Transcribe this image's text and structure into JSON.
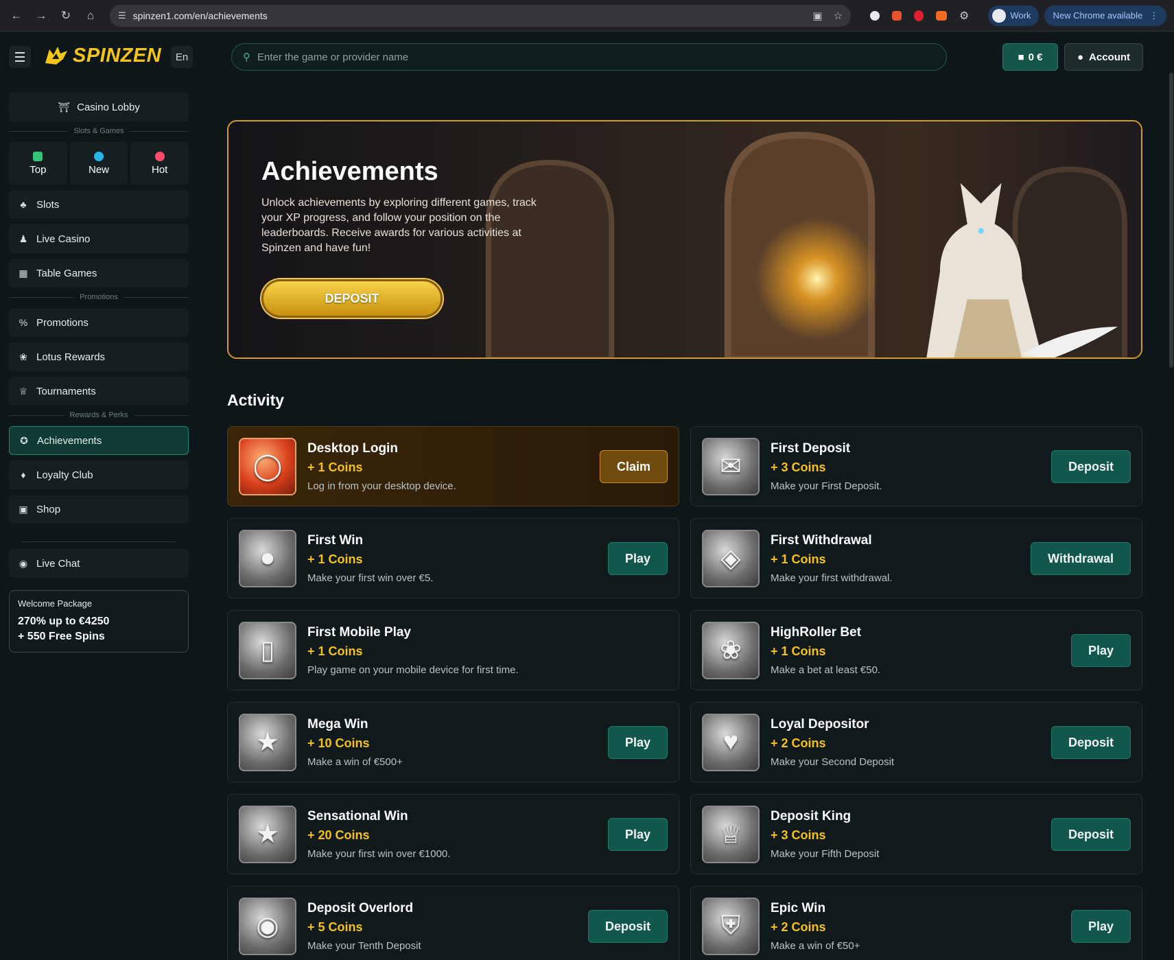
{
  "browser": {
    "url": "spinzen1.com/en/achievements",
    "profile_label": "Work",
    "update_label": "New Chrome available"
  },
  "header": {
    "logo_text": "SPINZEN",
    "language": "En",
    "search_placeholder": "Enter the game or provider name",
    "balance": "0 €",
    "account_label": "Account"
  },
  "sidebar": {
    "casino_lobby": "Casino Lobby",
    "slots_games_divider": "Slots & Games",
    "quick": [
      {
        "label": "Top",
        "color": "#35c27a"
      },
      {
        "label": "New",
        "color": "#2ab5e8"
      },
      {
        "label": "Hot",
        "color": "#ff4d6d"
      }
    ],
    "games": [
      "Slots",
      "Live Casino",
      "Table Games"
    ],
    "promotions_divider": "Promotions",
    "promos": [
      "Promotions",
      "Lotus Rewards",
      "Tournaments"
    ],
    "rewards_divider": "Rewards & Perks",
    "rewards": [
      "Achievements",
      "Loyalty Club",
      "Shop"
    ],
    "live_chat": "Live Chat",
    "welcome": {
      "title": "Welcome Package",
      "line1": "270% up to €4250",
      "line2": "+ 550 Free Spins"
    }
  },
  "hero": {
    "title": "Achievements",
    "description": "Unlock achievements by exploring different games, track your XP progress, and follow your position on the leaderboards. Receive awards for various activities at Spinzen and have fun!",
    "button": "DEPOSIT"
  },
  "activity": {
    "title": "Activity",
    "cards": [
      {
        "title": "Desktop Login",
        "coins": "+ 1 Coins",
        "desc": "Log in from your desktop device.",
        "button": "Claim",
        "icon": "lantern-icon"
      },
      {
        "title": "First Deposit",
        "coins": "+ 3 Coins",
        "desc": "Make your First Deposit.",
        "button": "Deposit",
        "icon": "envelope-icon"
      },
      {
        "title": "First Win",
        "coins": "+ 1 Coins",
        "desc": "Make your first win over €5.",
        "button": "Play",
        "icon": "coin-icon"
      },
      {
        "title": "First Withdrawal",
        "coins": "+ 1 Coins",
        "desc": "Make your first withdrawal.",
        "button": "Withdrawal",
        "icon": "money-bag-icon"
      },
      {
        "title": "First Mobile Play",
        "coins": "+ 1 Coins",
        "desc": "Play game on your mobile device for first time.",
        "button": "",
        "icon": "phone-icon"
      },
      {
        "title": "HighRoller Bet",
        "coins": "+ 1 Coins",
        "desc": "Make a bet at least €50.",
        "button": "Play",
        "icon": "lotus-icon"
      },
      {
        "title": "Mega Win",
        "coins": "+ 10 Coins",
        "desc": "Make a win of €500+",
        "button": "Play",
        "icon": "star-wreath-icon"
      },
      {
        "title": "Loyal Depositor",
        "coins": "+ 2 Coins",
        "desc": "Make your Second Deposit",
        "button": "Deposit",
        "icon": "heart-coin-icon"
      },
      {
        "title": "Sensational Win",
        "coins": "+ 20 Coins",
        "desc": "Make your first win over €1000.",
        "button": "Play",
        "icon": "star-wreath-icon"
      },
      {
        "title": "Deposit King",
        "coins": "+ 3 Coins",
        "desc": "Make your Fifth Deposit",
        "button": "Deposit",
        "icon": "crown-coins-icon"
      },
      {
        "title": "Deposit Overlord",
        "coins": "+ 5 Coins",
        "desc": "Make your Tenth Deposit",
        "button": "Deposit",
        "icon": "coin-pouch-icon"
      },
      {
        "title": "Epic Win",
        "coins": "+ 2 Coins",
        "desc": "Make a win of €50+",
        "button": "Play",
        "icon": "winged-shield-icon"
      }
    ]
  }
}
